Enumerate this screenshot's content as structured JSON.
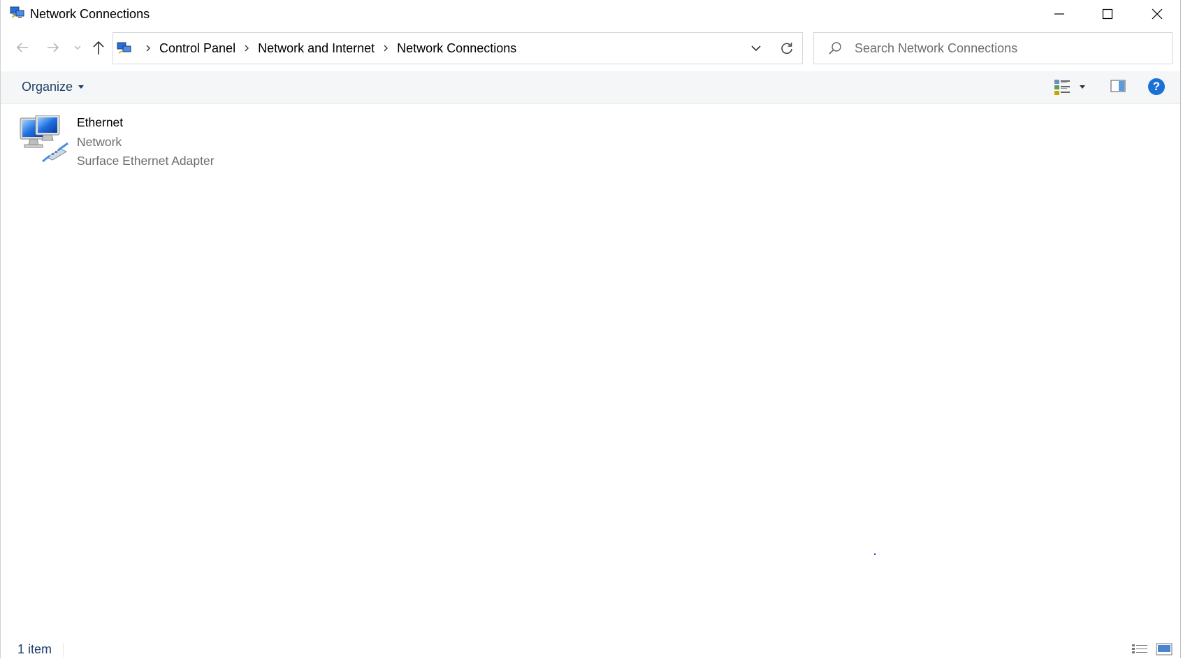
{
  "window": {
    "title": "Network Connections",
    "icon": "network-connections-icon",
    "buttons": {
      "minimize": "minimize-icon",
      "maximize": "maximize-icon",
      "close": "close-icon"
    }
  },
  "navigation": {
    "breadcrumb": [
      "Control Panel",
      "Network and Internet",
      "Network Connections"
    ],
    "search_placeholder": "Search Network Connections"
  },
  "commandbar": {
    "organize_label": "Organize"
  },
  "items": [
    {
      "name": "Ethernet",
      "status": "Network",
      "device": "Surface Ethernet Adapter",
      "icon": "ethernet-adapter-icon"
    }
  ],
  "statusbar": {
    "count": "1 item"
  },
  "colors": {
    "link_text": "#1e3f66",
    "secondary_text": "#6d6d6d",
    "accent": "#1a72d6",
    "commandbar_bg": "#f5f6f7"
  }
}
